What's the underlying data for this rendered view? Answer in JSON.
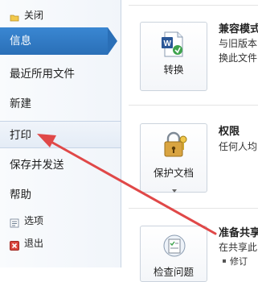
{
  "sidebar": {
    "close": "关闭",
    "info": "信息",
    "recent": "最近所用文件",
    "new": "新建",
    "print": "打印",
    "save_send": "保存并发送",
    "help": "帮助",
    "options": "选项",
    "exit": "退出"
  },
  "main": {
    "convert": {
      "button_label": "转换",
      "title": "兼容模式",
      "desc_lines": [
        "与旧版本",
        "换此文件"
      ]
    },
    "permissions": {
      "button_label": "保护文档",
      "title": "权限",
      "desc_lines": [
        "任何人均"
      ]
    },
    "prepare": {
      "button_label": "检查问题",
      "title": "准备共享",
      "desc_lines": [
        "在共享此",
        "修订"
      ]
    }
  },
  "colors": {
    "active_nav": "#2a6fb7",
    "annotation_arrow": "#e04848"
  }
}
